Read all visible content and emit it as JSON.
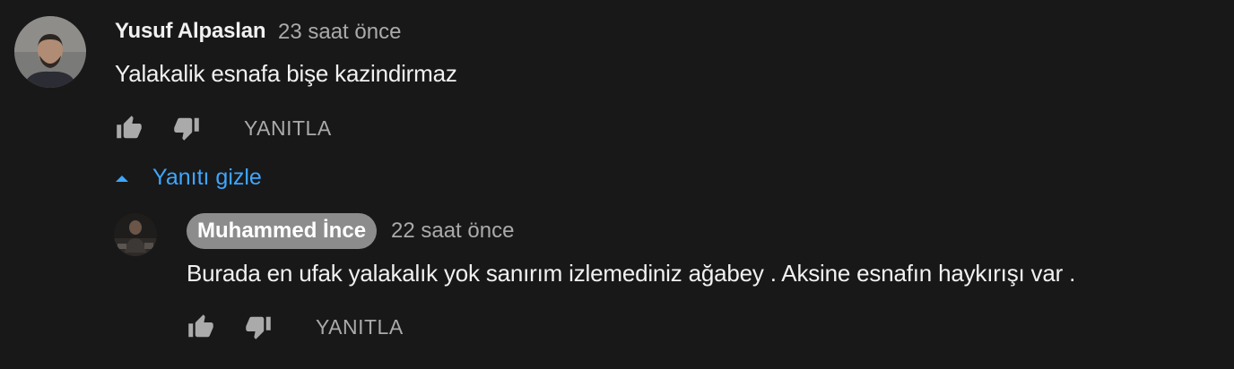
{
  "comment": {
    "author": "Yusuf Alpaslan",
    "time": "23 saat önce",
    "text": "Yalakalik esnafa bişe kazindirmaz",
    "reply_label": "YANITLA"
  },
  "replies_toggle": {
    "label": "Yanıtı gizle"
  },
  "reply": {
    "author": "Muhammed İnce",
    "time": "22 saat önce",
    "text": "Burada en ufak yalakalık yok sanırım izlemediniz ağabey . Aksine esnafın haykırışı var .",
    "reply_label": "YANITLA"
  },
  "colors": {
    "background": "#181818",
    "primary_text": "#f1f1f1",
    "secondary_text": "#aaaaaa",
    "link": "#3ea6ff",
    "author_chip": "#8c8c8c"
  },
  "icons": [
    "thumbs-up-icon",
    "thumbs-down-icon",
    "caret-up-icon"
  ]
}
